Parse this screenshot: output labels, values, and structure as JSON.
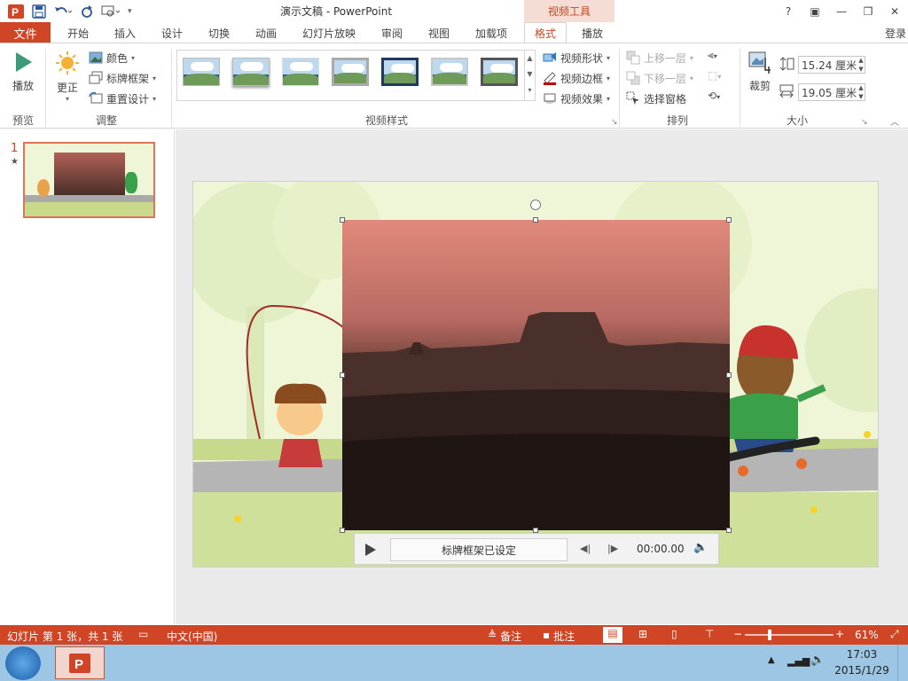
{
  "window": {
    "title": "演示文稿 - PowerPoint",
    "context_tab_header": "视频工具"
  },
  "qat": {
    "app_icon": "powerpoint-logo-icon",
    "save": "save-icon",
    "undo": "undo-icon",
    "redo": "redo-icon",
    "present": "present-from-start-icon"
  },
  "window_buttons": {
    "help": "?",
    "restore_ribbon": "▣",
    "minimize": "—",
    "maximize": "❐",
    "close": "✕"
  },
  "tabs": [
    "文件",
    "开始",
    "插入",
    "设计",
    "切换",
    "动画",
    "幻灯片放映",
    "审阅",
    "视图",
    "加载项",
    "格式",
    "播放"
  ],
  "login": "登录",
  "ribbon": {
    "groups": {
      "preview": "预览",
      "adjust": "调整",
      "video_styles": "视频样式",
      "arrange": "排列",
      "size": "大小"
    },
    "play": "播放",
    "correct": "更正",
    "color": "颜色",
    "poster_frame": "标牌框架",
    "reset_design": "重置设计",
    "video_shape": "视频形状",
    "video_border": "视频边框",
    "video_effects": "视频效果",
    "bring_forward": "上移一层",
    "send_backward": "下移一层",
    "selection_pane": "选择窗格",
    "crop": "裁剪",
    "height": "15.24 厘米",
    "width": "19.05 厘米"
  },
  "thumbnails": [
    {
      "number": "1",
      "marker": "★"
    }
  ],
  "player": {
    "status": "标牌框架已设定",
    "time": "00:00.00"
  },
  "status": {
    "slide_info": "幻灯片 第 1 张，共 1 张",
    "language": "中文(中国)",
    "notes": "备注",
    "comments": "批注",
    "zoom": "61%"
  },
  "taskbar": {
    "time": "17:03",
    "date": "2015/1/29"
  },
  "colors": {
    "accent": "#d04525",
    "context_tab": "#f5ddd6",
    "slide_bg": "#eff6d8"
  }
}
